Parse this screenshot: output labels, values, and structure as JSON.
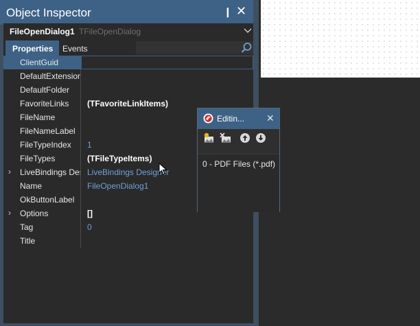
{
  "inspector": {
    "title": "Object Inspector",
    "pin_icon": "❙",
    "close_icon": "✕",
    "object_name": "FileOpenDialog1",
    "object_class": "TFileOpenDialog",
    "tabs": [
      {
        "label": "Properties",
        "active": true
      },
      {
        "label": "Events",
        "active": false
      }
    ],
    "rows": [
      {
        "name": "ClientGuid",
        "value": ""
      },
      {
        "name": "DefaultExtension",
        "value": ""
      },
      {
        "name": "DefaultFolder",
        "value": ""
      },
      {
        "name": "FavoriteLinks",
        "value": "(TFavoriteLinkItems)"
      },
      {
        "name": "FileName",
        "value": ""
      },
      {
        "name": "FileNameLabel",
        "value": ""
      },
      {
        "name": "FileTypeIndex",
        "value": "1"
      },
      {
        "name": "FileTypes",
        "value": "(TFileTypeItems)"
      },
      {
        "name": "LiveBindings Designer",
        "value": "LiveBindings Designer"
      },
      {
        "name": "Name",
        "value": "FileOpenDialog1"
      },
      {
        "name": "OkButtonLabel",
        "value": ""
      },
      {
        "name": "Options",
        "value": "[]"
      },
      {
        "name": "Tag",
        "value": "0"
      },
      {
        "name": "Title",
        "value": ""
      }
    ],
    "expand_glyph": "›"
  },
  "dialog": {
    "title": "Editin...",
    "close_icon": "✕",
    "items": [
      "0 - PDF Files (*.pdf)"
    ]
  },
  "colors": {
    "accent": "#3d6285",
    "panel_bg": "#2a2a2a",
    "link": "#6ea0d8"
  }
}
